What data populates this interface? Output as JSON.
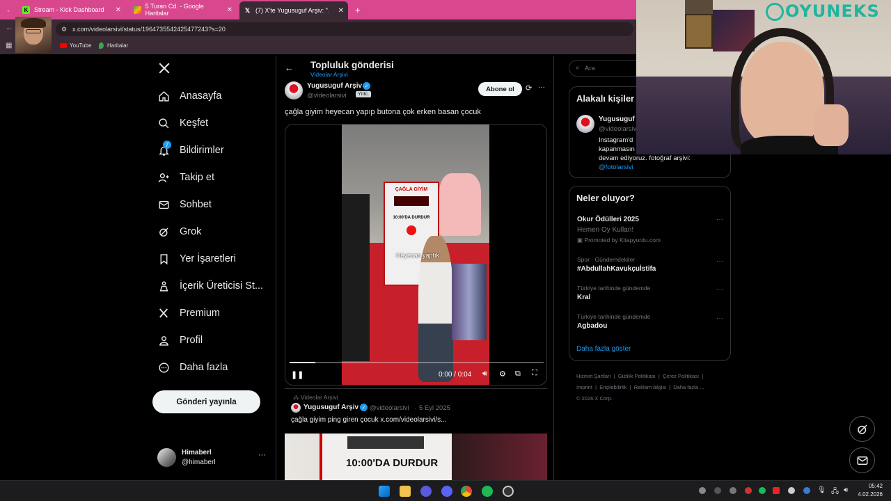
{
  "browser": {
    "tabs": [
      {
        "label": "Stream - Kick Dashboard"
      },
      {
        "label": "5 Turan Cd. - Google Haritalar"
      },
      {
        "label": "(7) X'te Yugusuguf Arşiv: \"..."
      }
    ],
    "url": "x.com/videolarsivi/status/1964735542425477243?s=20",
    "bookmarks": [
      "YouTube",
      "Haritalar"
    ]
  },
  "nav": {
    "items": [
      "Anasayfa",
      "Keşfet",
      "Bildirimler",
      "Takip et",
      "Sohbet",
      "Grok",
      "Yer İşaretleri",
      "İçerik Üreticisi St...",
      "Premium",
      "Profil",
      "Daha fazla"
    ],
    "notif_badge": "7",
    "post_button": "Gönderi yayınla",
    "user_name": "Himaberl",
    "user_handle": "@himaberl"
  },
  "header": {
    "title": "Topluluk gönderisi",
    "subtitle": "Videolar Arşivi"
  },
  "post": {
    "author": "Yugusuguf Arşiv",
    "handle": "@videolarsivi",
    "role_badge": "Yntc.",
    "follow_label": "Abone ol",
    "text": "çağla giyim heyecan yapıp butona çok erken basan çocuk",
    "video_caption": "Heyecan yaptık",
    "video_time": "0:00 / 0:04",
    "progress": 0.1
  },
  "next_post": {
    "community": "Videolar Arşivi",
    "author": "Yugusuguf Arşiv",
    "handle": "@videolarsivi",
    "date": "5 Eyl 2025",
    "text": "çağla giyim ping giren çocuk  x.com/videolarsivi/s...",
    "preview_text": "10:00'DA DURDUR"
  },
  "sidebar": {
    "search_placeholder": "Ara",
    "related_title": "Alakalı kişiler",
    "related_name": "Yugusuguf",
    "related_handle": "@videolarsivi",
    "related_bio1": "Instagram'd",
    "related_bio2": "kapanmasın",
    "related_bio3": "devam ediyoruz. fotoğraf arşivi:",
    "related_link": "@fotolarsivi",
    "trends_title": "Neler oluyor?",
    "trends": [
      {
        "context": "",
        "name": "Okur Ödülleri 2025",
        "sub": "Hemen Oy Kullan!",
        "promo": "Promoted by Kitapyurdu.com"
      },
      {
        "context": "Spor · Gündemdekiler",
        "name": "#AbdullahKavukçuİstifa"
      },
      {
        "context": "Türkiye tarihinde gündemde",
        "name": "Kral"
      },
      {
        "context": "Türkiye tarihinde gündemde",
        "name": "Agbadou"
      }
    ],
    "show_more": "Daha fazla göster",
    "footer": [
      "Hizmet Şartları",
      "Gizlilik Politikası",
      "Çerez Politikası",
      "Imprint",
      "Erişilebilirlik",
      "Reklam bilgisi",
      "Daha fazla ..."
    ],
    "copyright": "© 2026 X Corp."
  },
  "overlay": {
    "logo_text": "OYUNEKS"
  },
  "taskbar": {
    "time": "05:42",
    "date": "4.02.2026"
  }
}
